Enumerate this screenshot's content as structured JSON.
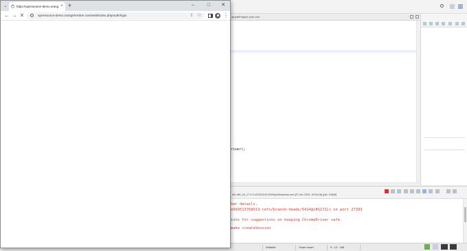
{
  "ide": {
    "editor_path": "ampleProject/ pom.xml",
    "editor_code": "river);",
    "console_info": "nt2.x86_64_17.0.5.v20221102-0933\\jre\\bin\\javaw.exe  (23 Jan 2023, 19:54:18) [pid: 10840]",
    "console_lines": [
      "her details.",
      "e993513758913-refs/branch-heads/5414@{#1172}) on port 27393",
      "",
      "ions for suggestions on keeping ChromeDriver safe.",
      "",
      "make createSession"
    ],
    "status": {
      "writable": "Writable",
      "insert_mode": "Smart Insert",
      "position": "9 : 10 : 186"
    }
  },
  "chrome": {
    "tab_title": "https://opensource-demo.orang",
    "url": "opensource-demo.orangehrmlive.com/web/index.php/auth/login",
    "icons": {
      "tab_search": "chevron-down-icon",
      "new_tab": "plus-icon",
      "back": "arrow-left-icon",
      "forward": "arrow-right-icon",
      "stop": "close-icon",
      "menu": "more-vert-icon"
    }
  },
  "colors": {
    "console_error": "#d33a2c",
    "chrome_tabstrip": "#dee1e6",
    "omnibox": "#f1f3f4"
  }
}
